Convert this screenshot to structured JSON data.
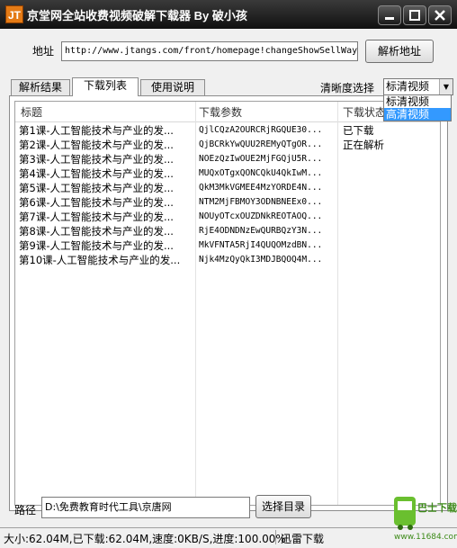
{
  "window": {
    "app_icon_text": "JT",
    "title": "京堂网全站收费视频破解下载器 By 破小孩"
  },
  "address": {
    "label": "地址",
    "value": "http://www.jtangs.com/front/homepage!changeShowSellWay",
    "parse_button": "解析地址"
  },
  "tabs": [
    {
      "label": "解析结果",
      "active": false
    },
    {
      "label": "下载列表",
      "active": true
    },
    {
      "label": "使用说明",
      "active": false
    }
  ],
  "quality": {
    "label": "清晰度选择",
    "selected": "标清视频",
    "options": [
      "标清视频",
      "高清视频"
    ],
    "highlighted": "高清视频"
  },
  "table": {
    "columns": [
      "标题",
      "下载参数",
      "下载状态"
    ],
    "rows": [
      {
        "title": "第1课-人工智能技术与产业的发...",
        "param": "QjlCQzA2OURCRjRGQUE30...",
        "status": "已下载"
      },
      {
        "title": "第2课-人工智能技术与产业的发...",
        "param": "QjBCRkYwQUU2REMyQTgOR...",
        "status": "正在解析"
      },
      {
        "title": "第3课-人工智能技术与产业的发...",
        "param": "NOEzQzIwOUE2MjFGQjU5R...",
        "status": ""
      },
      {
        "title": "第4课-人工智能技术与产业的发...",
        "param": "MUQxOTgxQONCQkU4QkIwM...",
        "status": ""
      },
      {
        "title": "第5课-人工智能技术与产业的发...",
        "param": "QkM3MkVGMEE4MzYORDE4N...",
        "status": ""
      },
      {
        "title": "第6课-人工智能技术与产业的发...",
        "param": "NTM2MjFBMOY3ODNBNEEx0...",
        "status": ""
      },
      {
        "title": "第7课-人工智能技术与产业的发...",
        "param": "NOUyOTcxOUZDNkREOTAOQ...",
        "status": ""
      },
      {
        "title": "第8课-人工智能技术与产业的发...",
        "param": "RjE4ODNDNzEwQURBQzY3N...",
        "status": ""
      },
      {
        "title": "第9课-人工智能技术与产业的发...",
        "param": "MkVFNTA5RjI4QUQOMzdBN...",
        "status": ""
      },
      {
        "title": "第10课-人工智能技术与产业的发...",
        "param": "Njk4MzQyQkI3MDJBQOQ4M...",
        "status": ""
      }
    ]
  },
  "path": {
    "label": "路径",
    "value": "D:\\免费教育时代工具\\京唐网",
    "select_button": "选择目录",
    "download_button": "迅雷下载"
  },
  "status_bar": {
    "text": "大小:62.04M,已下载:62.04M,速度:0KB/S,进度:100.00%"
  },
  "watermark": {
    "text": "巴士下载",
    "url": "www.11684.com"
  },
  "colors": {
    "titlebar": "#1a1a1a",
    "selection": "#3399ff",
    "app_icon": "#e47b16"
  }
}
